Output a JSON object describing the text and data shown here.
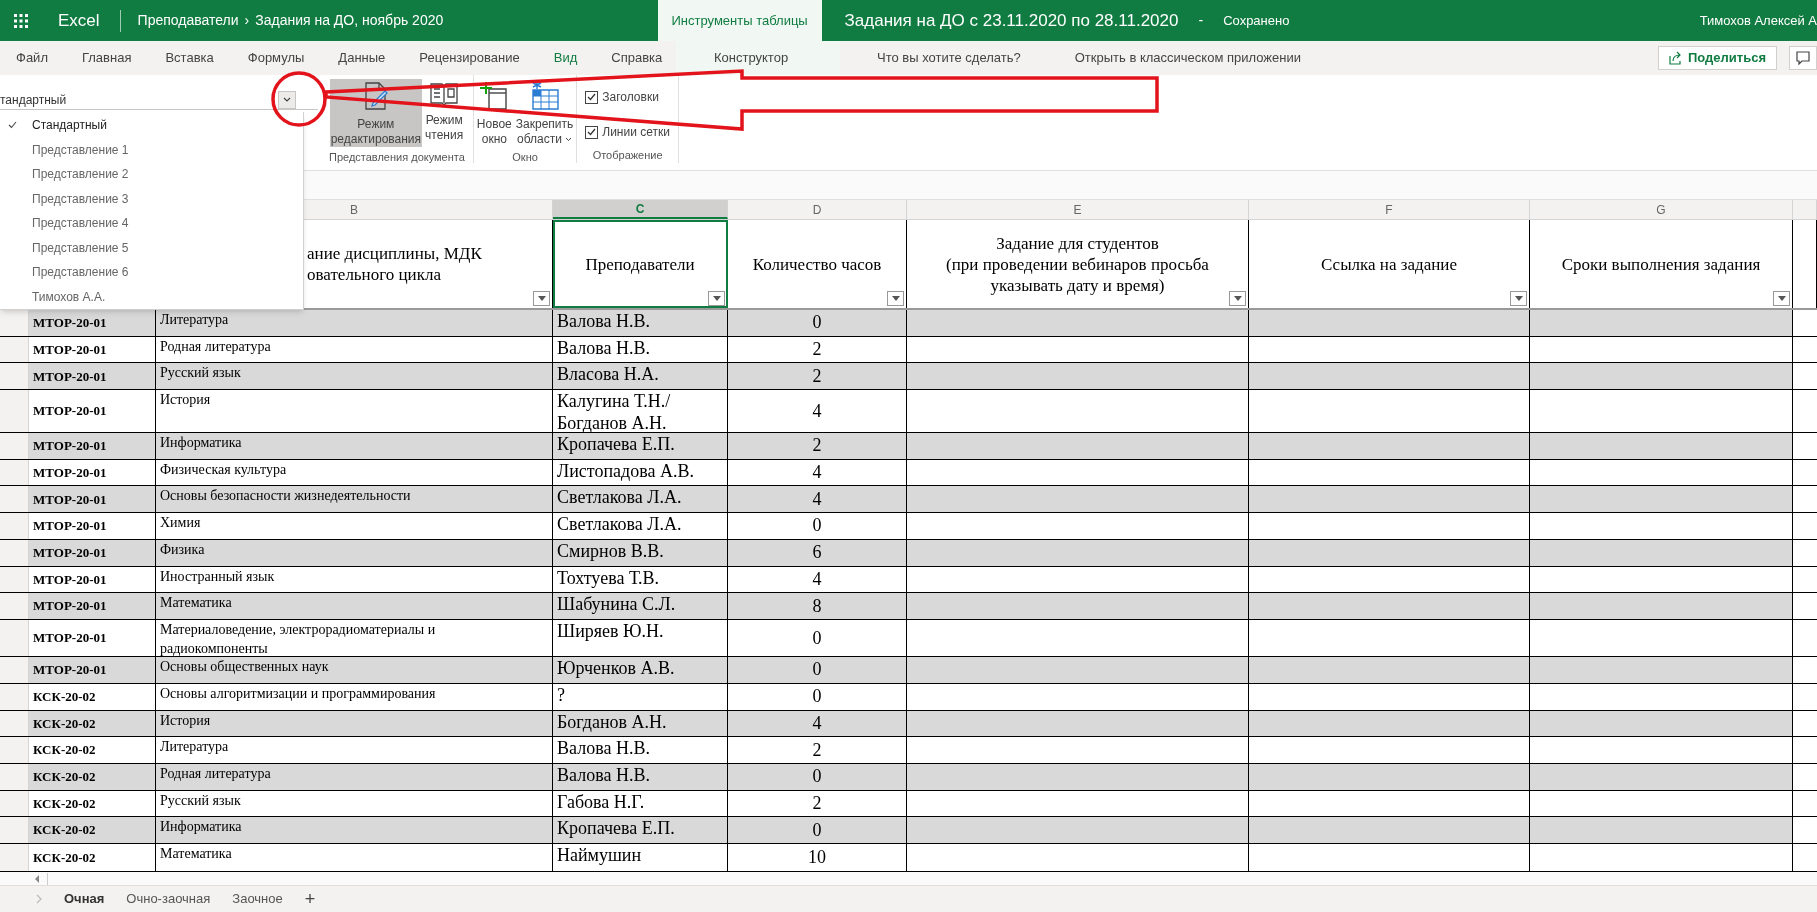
{
  "app_bar": {
    "app": "Excel",
    "breadcrumb": [
      "Преподаватели",
      "Задания на ДО, ноябрь 2020"
    ],
    "breadcrumb_separator": "›",
    "contextual_tab": "Инструменты таблицы",
    "document_title": "Задания на ДО с 23.11.2020 по 28.11.2020",
    "separator": "-",
    "save_status": "Сохранено",
    "user": "Тимохов Алексей А"
  },
  "menu": [
    {
      "label": "Файл",
      "selected": false
    },
    {
      "label": "Главная",
      "selected": false
    },
    {
      "label": "Вставка",
      "selected": false
    },
    {
      "label": "Формулы",
      "selected": false
    },
    {
      "label": "Данные",
      "selected": false
    },
    {
      "label": "Рецензирование",
      "selected": false
    },
    {
      "label": "Вид",
      "selected": true
    },
    {
      "label": "Справка",
      "selected": false
    }
  ],
  "contextual_menu": "Конструктор",
  "tell_me": "Что вы хотите сделать?",
  "open_desktop": "Открыть в классическом приложении",
  "share_button": "Поделиться",
  "ribbon": {
    "view_combo": {
      "value": "тандартный",
      "options": [
        {
          "label": "Стандартный",
          "selected": true
        },
        {
          "label": "Представление 1",
          "selected": false
        },
        {
          "label": "Представление 2",
          "selected": false
        },
        {
          "label": "Представление 3",
          "selected": false
        },
        {
          "label": "Представление 4",
          "selected": false
        },
        {
          "label": "Представление 5",
          "selected": false
        },
        {
          "label": "Представление 6",
          "selected": false
        },
        {
          "label": "Тимохов А.А.",
          "selected": false
        }
      ]
    },
    "groups": [
      {
        "label": "Представления документа",
        "buttons": [
          {
            "kind": "edit",
            "label": "Режим\nредактирования",
            "selected": true
          },
          {
            "kind": "read",
            "label": "Режим\nчтения",
            "selected": false
          }
        ]
      },
      {
        "label": "Окно",
        "buttons": [
          {
            "kind": "new_window",
            "label": "Новое\nокно",
            "selected": false
          },
          {
            "kind": "freeze",
            "label": "Закрепить\nобласти",
            "selected": false
          }
        ]
      },
      {
        "label": "Отображение",
        "checkboxes": [
          {
            "label": "Заголовки",
            "checked": true
          },
          {
            "label": "Линии сетки",
            "checked": true
          }
        ]
      }
    ]
  },
  "sheet": {
    "columns": [
      {
        "letter": "B",
        "heading": "ание дисциплины, МДК\nовательного цикла",
        "selected": false,
        "filter": true
      },
      {
        "letter": "C",
        "heading": "Преподаватели",
        "selected": true,
        "filter": true
      },
      {
        "letter": "D",
        "heading": "Количество часов",
        "selected": false,
        "filter": true
      },
      {
        "letter": "E",
        "heading": "Задание для студентов\n(при проведении вебинаров просьба\nуказывать дату и время)",
        "selected": false,
        "filter": true
      },
      {
        "letter": "F",
        "heading": "Ссылка на задание",
        "selected": false,
        "filter": true
      },
      {
        "letter": "G",
        "heading": "Сроки выполнения задания",
        "selected": false,
        "filter": true
      },
      {
        "selected": false,
        "filter": false
      }
    ],
    "rows": [
      {
        "group": "МТОР-20-01",
        "discipline": "Литература",
        "teacher": "Валова Н.В.",
        "hours": "0"
      },
      {
        "group": "МТОР-20-01",
        "discipline": "Родная литература",
        "teacher": "Валова Н.В.",
        "hours": "2"
      },
      {
        "group": "МТОР-20-01",
        "discipline": "Русский язык",
        "teacher": "Власова Н.А.",
        "hours": "2"
      },
      {
        "group": "МТОР-20-01",
        "discipline": "История",
        "teacher": "Калугина Т.Н./Богданов А.Н.",
        "hours": "4"
      },
      {
        "group": "МТОР-20-01",
        "discipline": "Информатика",
        "teacher": "Кропачева Е.П.",
        "hours": "2"
      },
      {
        "group": "МТОР-20-01",
        "discipline": "Физическая культура",
        "teacher": "Листопадова А.В.",
        "hours": "4"
      },
      {
        "group": "МТОР-20-01",
        "discipline": "Основы безопасности жизнедеятельности",
        "teacher": "Светлакова Л.А.",
        "hours": "4"
      },
      {
        "group": "МТОР-20-01",
        "discipline": "Химия",
        "teacher": "Светлакова Л.А.",
        "hours": "0"
      },
      {
        "group": "МТОР-20-01",
        "discipline": "Физика",
        "teacher": "Смирнов В.В.",
        "hours": "6"
      },
      {
        "group": "МТОР-20-01",
        "discipline": "Иностранный язык",
        "teacher": "Тохтуева Т.В.",
        "hours": "4"
      },
      {
        "group": "МТОР-20-01",
        "discipline": "Математика",
        "teacher": "Шабунина С.Л.",
        "hours": "8"
      },
      {
        "group": "МТОР-20-01",
        "discipline": "Материаловедение, электрорадиоматериалы и радиокомпоненты",
        "teacher": "Ширяев Ю.Н.",
        "hours": "0"
      },
      {
        "group": "МТОР-20-01",
        "discipline": "Основы общественных наук",
        "teacher": "Юрченков А.В.",
        "hours": "0"
      },
      {
        "group": "КСК-20-02",
        "discipline": "Основы алгоритмизации и программирования",
        "teacher": "?",
        "hours": "0"
      },
      {
        "group": "КСК-20-02",
        "discipline": "История",
        "teacher": "Богданов А.Н.",
        "hours": "4"
      },
      {
        "group": "КСК-20-02",
        "discipline": "Литература",
        "teacher": "Валова Н.В.",
        "hours": "2"
      },
      {
        "group": "КСК-20-02",
        "discipline": "Родная литература",
        "teacher": "Валова Н.В.",
        "hours": "0"
      },
      {
        "group": "КСК-20-02",
        "discipline": "Русский язык",
        "teacher": "Габова Н.Г.",
        "hours": "2"
      },
      {
        "group": "КСК-20-02",
        "discipline": "Информатика",
        "teacher": "Кропачева Е.П.",
        "hours": "0"
      },
      {
        "group": "КСК-20-02",
        "discipline": "Математика",
        "teacher": "Наймушин",
        "hours": "10"
      }
    ]
  },
  "sheet_tabs": [
    {
      "label": "Очная",
      "selected": true
    },
    {
      "label": "Очно-заочная",
      "selected": false
    },
    {
      "label": "Заочное",
      "selected": false
    }
  ],
  "add_sheet": "+"
}
